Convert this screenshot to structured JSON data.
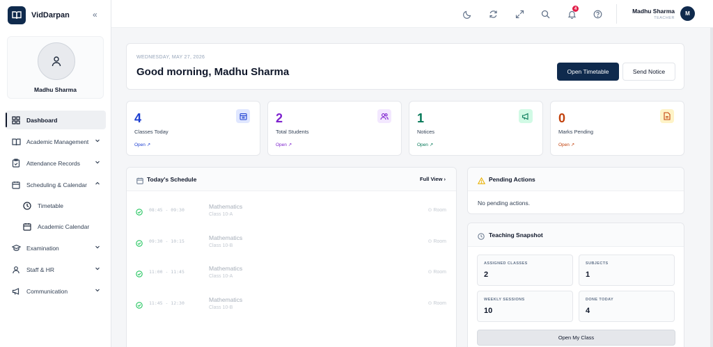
{
  "brand": {
    "name": "VidDarpan"
  },
  "profile": {
    "name": "Madhu Sharma"
  },
  "nav": {
    "items": [
      {
        "label": "Dashboard"
      },
      {
        "label": "Academic Management"
      },
      {
        "label": "Attendance Records"
      },
      {
        "label": "Scheduling & Calendar"
      },
      {
        "label": "Timetable"
      },
      {
        "label": "Academic Calendar"
      },
      {
        "label": "Examination"
      },
      {
        "label": "Staff & HR"
      },
      {
        "label": "Communication"
      }
    ]
  },
  "topbar": {
    "notification_count": "4",
    "user_name": "Madhu Sharma",
    "user_role": "TEACHER",
    "user_initial": "M"
  },
  "greeting": {
    "date": "WEDNESDAY, MAY 27, 2026",
    "title": "Good morning, Madhu Sharma",
    "primary_button": "Open Timetable",
    "secondary_button": "Send Notice"
  },
  "stats": [
    {
      "value": "4",
      "label": "Classes Today",
      "link": "Open ↗",
      "color": "#1d3fd1",
      "bg": "#e0e7ff"
    },
    {
      "value": "2",
      "label": "Total Students",
      "link": "Open ↗",
      "color": "#7e22ce",
      "bg": "#f3e8ff"
    },
    {
      "value": "1",
      "label": "Notices",
      "link": "Open ↗",
      "color": "#047857",
      "bg": "#d1fae5"
    },
    {
      "value": "0",
      "label": "Marks Pending",
      "link": "Open ↗",
      "color": "#c2410c",
      "bg": "#fef3c7"
    }
  ],
  "schedule": {
    "title": "Today's Schedule",
    "full_view": "Full View",
    "rows": [
      {
        "time": "08:45 - 09:30",
        "subject": "Mathematics",
        "class": "Class 10-A",
        "room": "Room"
      },
      {
        "time": "09:30 - 10:15",
        "subject": "Mathematics",
        "class": "Class 10-B",
        "room": "Room"
      },
      {
        "time": "11:00 - 11:45",
        "subject": "Mathematics",
        "class": "Class 10-A",
        "room": "Room"
      },
      {
        "time": "11:45 - 12:30",
        "subject": "Mathematics",
        "class": "Class 10-B",
        "room": "Room"
      }
    ]
  },
  "pending": {
    "title": "Pending Actions",
    "body": "No pending actions."
  },
  "snapshot": {
    "title": "Teaching Snapshot",
    "items": [
      {
        "label": "ASSIGNED CLASSES",
        "value": "2"
      },
      {
        "label": "SUBJECTS",
        "value": "1"
      },
      {
        "label": "WEEKLY SESSIONS",
        "value": "10"
      },
      {
        "label": "DONE TODAY",
        "value": "4"
      }
    ],
    "button": "Open My Class"
  },
  "colors": {
    "brand_dark": "#0f2a4d",
    "success": "#22c55e",
    "warning": "#eab308",
    "badge": "#e11d48"
  }
}
